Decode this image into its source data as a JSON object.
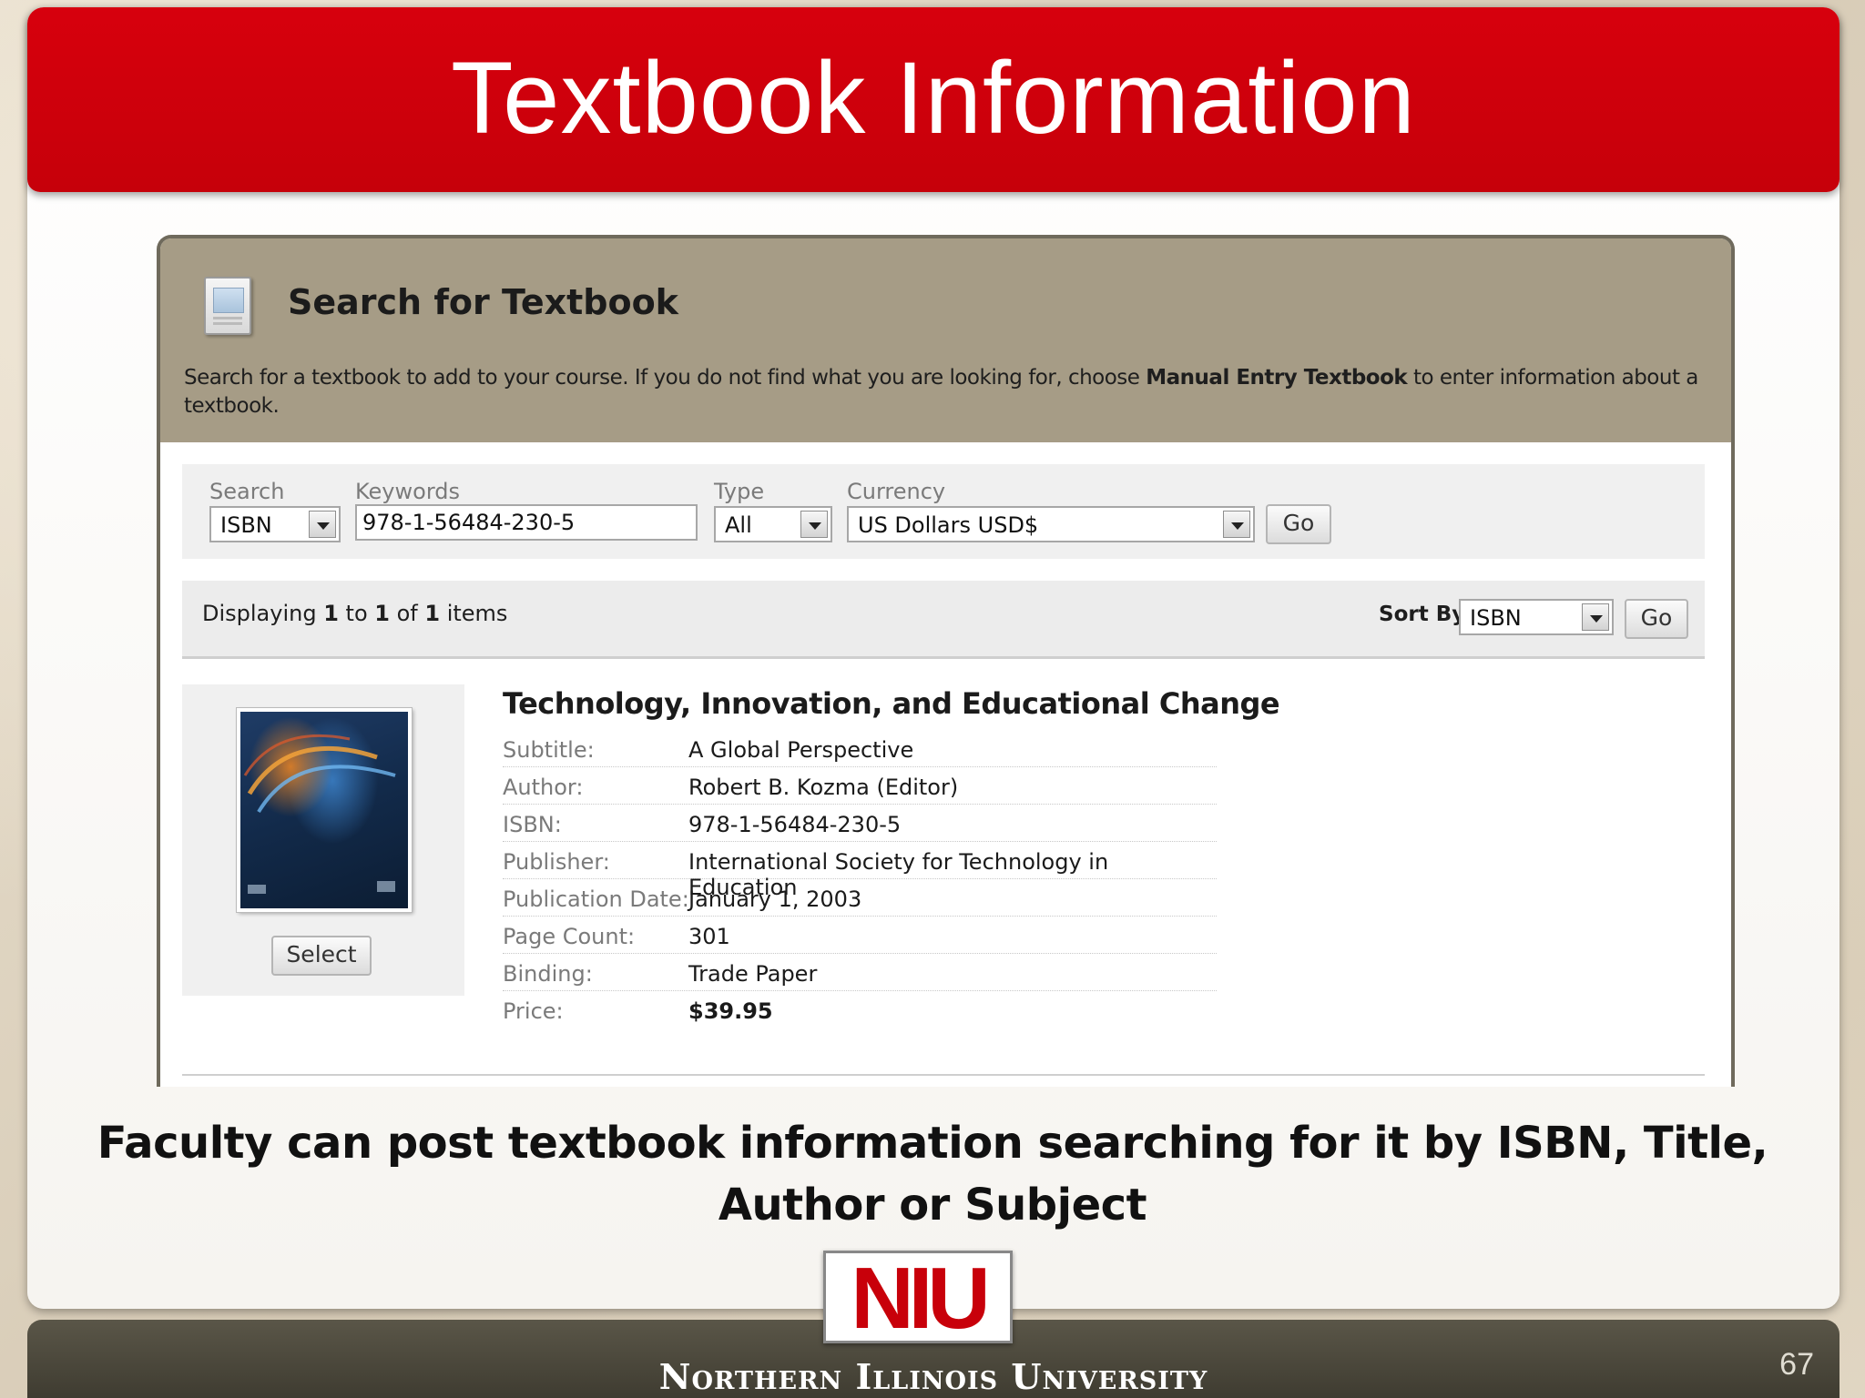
{
  "slide": {
    "title": "Textbook Information",
    "caption": "Faculty can post textbook information searching for it by ISBN, Title, Author or Subject",
    "logo_text": "NIU",
    "footer_text": "Northern Illinois University",
    "page_number": "67"
  },
  "panel": {
    "title": "Search for Textbook",
    "description_before": "Search for a textbook to add to your course. If you do not find what you are looking for, choose ",
    "description_bold": "Manual Entry Textbook",
    "description_after": " to enter information about a textbook."
  },
  "search": {
    "search_label": "Search",
    "search_value": "ISBN",
    "keywords_label": "Keywords",
    "keywords_value": "978-1-56484-230-5",
    "type_label": "Type",
    "type_value": "All",
    "currency_label": "Currency",
    "currency_value": "US Dollars USD$",
    "go_label": "Go"
  },
  "results": {
    "display_prefix": "Displaying ",
    "display_from": "1",
    "display_to_word": " to ",
    "display_to": "1",
    "display_of_word": " of ",
    "display_total": "1",
    "display_suffix": " items",
    "sort_label": "Sort By:",
    "sort_value": "ISBN",
    "go_label": "Go"
  },
  "book": {
    "title": "Technology, Innovation, and Educational Change",
    "select_label": "Select",
    "details": [
      {
        "key": "Subtitle:",
        "value": "A Global Perspective"
      },
      {
        "key": "Author:",
        "value": "Robert B. Kozma (Editor)"
      },
      {
        "key": "ISBN:",
        "value": "978-1-56484-230-5"
      },
      {
        "key": "Publisher:",
        "value": "International Society for Technology in Education"
      },
      {
        "key": "Publication Date:",
        "value": "January 1, 2003"
      },
      {
        "key": "Page Count:",
        "value": "301"
      },
      {
        "key": "Binding:",
        "value": "Trade Paper"
      },
      {
        "key": "Price:",
        "value": "$39.95"
      }
    ]
  },
  "colors": {
    "title_bar": "#d7000d",
    "panel_header": "#a69c86",
    "footer": "#4a4739",
    "logo": "#c8000a"
  }
}
